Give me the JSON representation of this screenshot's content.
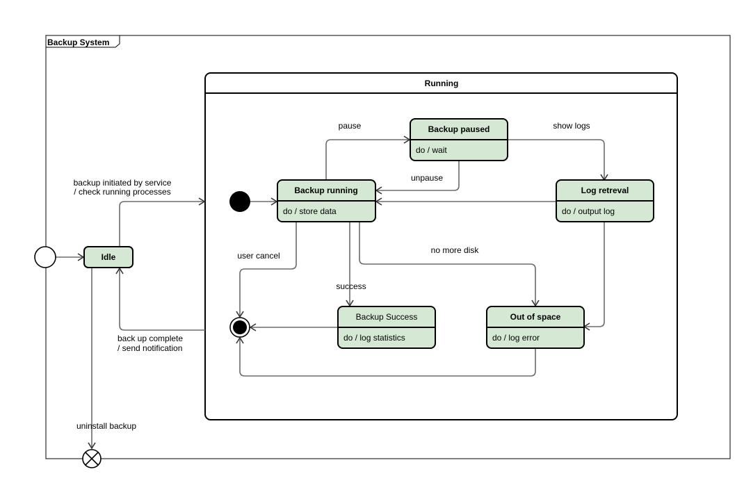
{
  "frame": {
    "title": "Backup System"
  },
  "composite_state": {
    "title": "Running"
  },
  "states": {
    "idle": {
      "name": "Idle"
    },
    "backup_running": {
      "name": "Backup running",
      "activity": "do / store data"
    },
    "backup_paused": {
      "name": "Backup paused",
      "activity": "do / wait"
    },
    "log_retrieval": {
      "name": "Log retreval",
      "activity": "do / output log"
    },
    "backup_success": {
      "name": "Backup Success",
      "activity": "do / log statistics"
    },
    "out_of_space": {
      "name": "Out of space",
      "activity": "do / log error"
    }
  },
  "transitions": {
    "initiated_line1": "backup initiated by service",
    "initiated_line2": "/ check running processes",
    "complete_line1": "back up complete",
    "complete_line2": "/ send notification",
    "pause": "pause",
    "unpause": "unpause",
    "show_logs": "show logs",
    "user_cancel": "user cancel",
    "success": "success",
    "no_more_disk": "no more disk",
    "uninstall": "uninstall backup"
  },
  "colors": {
    "state_fill": "#d5e8d4",
    "edge": "#6b6b6b"
  }
}
